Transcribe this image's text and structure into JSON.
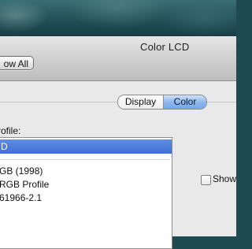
{
  "window": {
    "title": "Color LCD",
    "show_all_label": "ow All"
  },
  "tabs": [
    {
      "label": "Display",
      "selected": false
    },
    {
      "label": "Color",
      "selected": true
    }
  ],
  "color_panel": {
    "profile_label": "rofile:",
    "profiles": [
      {
        "label": "D",
        "selected": true
      },
      {
        "label": "GB (1998)",
        "selected": false
      },
      {
        "label": "RGB Profile",
        "selected": false
      },
      {
        "label": "61966-2.1",
        "selected": false
      }
    ],
    "show_checkbox": {
      "label": "Show",
      "checked": false
    }
  },
  "colors": {
    "selection": "#3d6fd6",
    "selected_tab": "#8fb7eb"
  }
}
